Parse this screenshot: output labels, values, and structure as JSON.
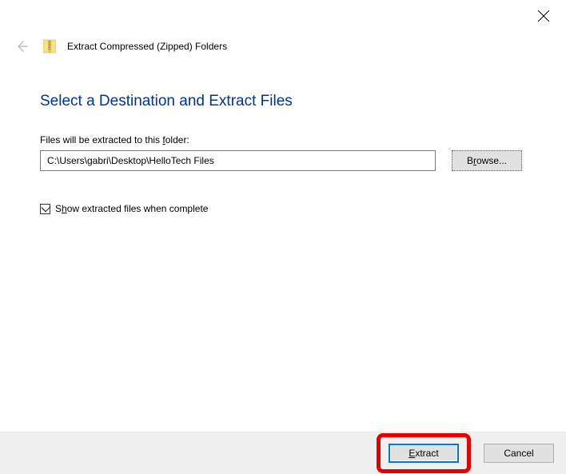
{
  "header": {
    "title": "Extract Compressed (Zipped) Folders"
  },
  "content": {
    "heading": "Select a Destination and Extract Files",
    "folder_label_pre": "Files will be extracted to this ",
    "folder_label_u": "f",
    "folder_label_post": "older:",
    "path_value": "C:\\Users\\gabri\\Desktop\\HelloTech Files",
    "browse_pre": "B",
    "browse_u": "r",
    "browse_post": "owse...",
    "show_label_pre": "S",
    "show_label_u": "h",
    "show_label_post": "ow extracted files when complete"
  },
  "footer": {
    "extract_u": "E",
    "extract_post": "xtract",
    "cancel": "Cancel"
  }
}
